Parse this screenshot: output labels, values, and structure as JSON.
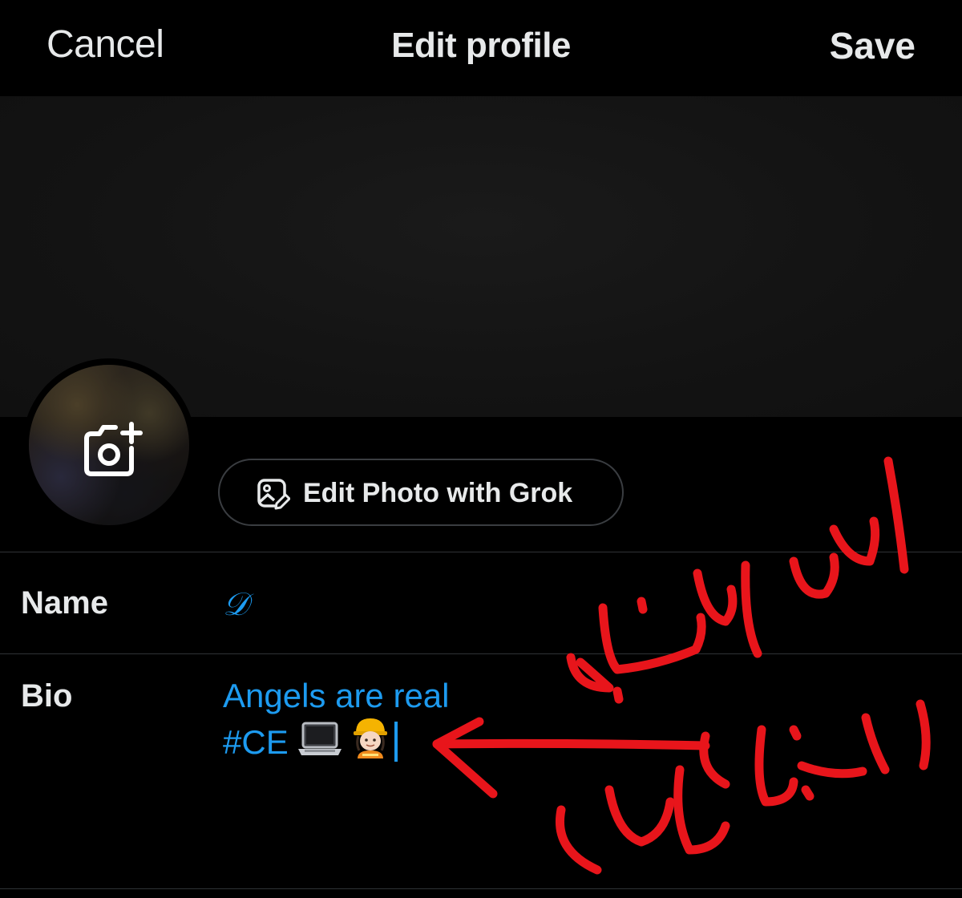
{
  "nav": {
    "cancel_label": "Cancel",
    "title": "Edit profile",
    "save_label": "Save"
  },
  "grok_button": {
    "label": "Edit Photo with Grok",
    "icon": "image-edit-icon"
  },
  "avatar": {
    "icon": "camera-plus-icon"
  },
  "fields": {
    "name": {
      "label": "Name",
      "value": "𝒟"
    },
    "bio": {
      "label": "Bio",
      "line1": "Angels are real",
      "line2": "#CE"
    }
  },
  "bio_emojis": [
    "laptop-emoji",
    "construction-worker-emoji"
  ],
  "annotation": {
    "text_line1": "اساسيات",
    "text_line2": "التقبول",
    "color": "#e8151b"
  },
  "colors": {
    "background": "#000000",
    "accent": "#1d9bf0",
    "text": "#e7e9ea",
    "divider": "#2f3336"
  }
}
